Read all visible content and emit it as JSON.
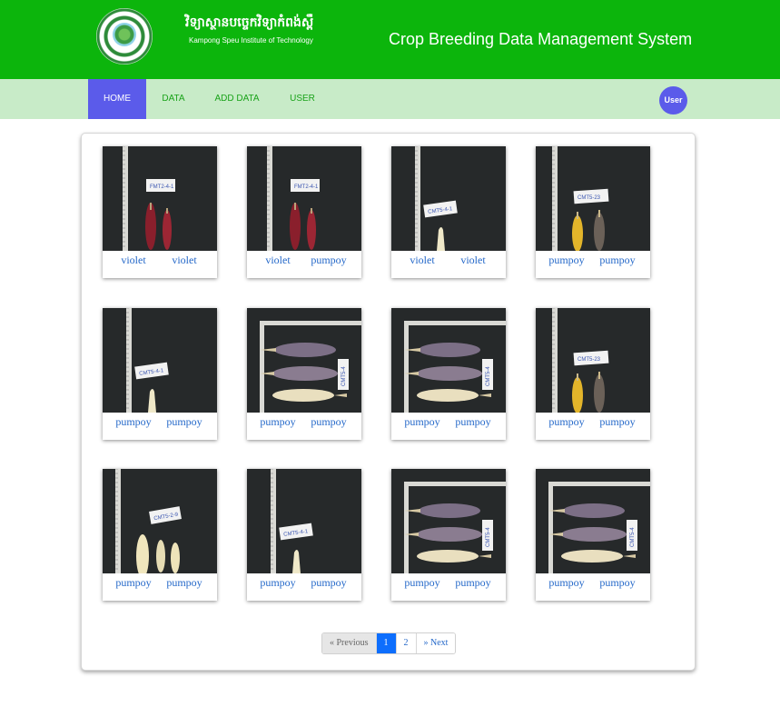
{
  "header": {
    "institute_kh": "វិទ្យាស្ថានបច្ចេកវិទ្យាកំពង់ស្ពឺ",
    "institute_en": "Kampong Speu Institute of Technology",
    "app_title": "Crop Breeding Data Management System"
  },
  "nav": {
    "items": [
      "HOME",
      "DATA",
      "ADD DATA",
      "USER"
    ],
    "active": "HOME",
    "user_label": "User"
  },
  "gallery": [
    {
      "a": "violet",
      "b": "violet",
      "photo": "red-corn-vertical"
    },
    {
      "a": "violet",
      "b": "pumpoy",
      "photo": "red-corn-vertical"
    },
    {
      "a": "violet",
      "b": "violet",
      "photo": "single-white-corn"
    },
    {
      "a": "pumpoy",
      "b": "pumpoy",
      "photo": "yellow-speckled-corn"
    },
    {
      "a": "pumpoy",
      "b": "pumpoy",
      "photo": "single-white-corn"
    },
    {
      "a": "pumpoy",
      "b": "pumpoy",
      "photo": "three-corn-horizontal"
    },
    {
      "a": "pumpoy",
      "b": "pumpoy",
      "photo": "three-corn-horizontal"
    },
    {
      "a": "pumpoy",
      "b": "pumpoy",
      "photo": "yellow-speckled-corn"
    },
    {
      "a": "pumpoy",
      "b": "pumpoy",
      "photo": "three-corn-vertical"
    },
    {
      "a": "pumpoy",
      "b": "pumpoy",
      "photo": "single-white-corn"
    },
    {
      "a": "pumpoy",
      "b": "pumpoy",
      "photo": "three-corn-horizontal"
    },
    {
      "a": "pumpoy",
      "b": "pumpoy",
      "photo": "three-corn-horizontal"
    }
  ],
  "pagination": {
    "previous": "« Previous",
    "pages": [
      "1",
      "2"
    ],
    "current": "1",
    "next": "» Next"
  },
  "colors": {
    "header_green": "#0cb50c",
    "nav_bg": "#c8ebc8",
    "active_purple": "#5b5bea",
    "link_blue": "#2468c9"
  }
}
